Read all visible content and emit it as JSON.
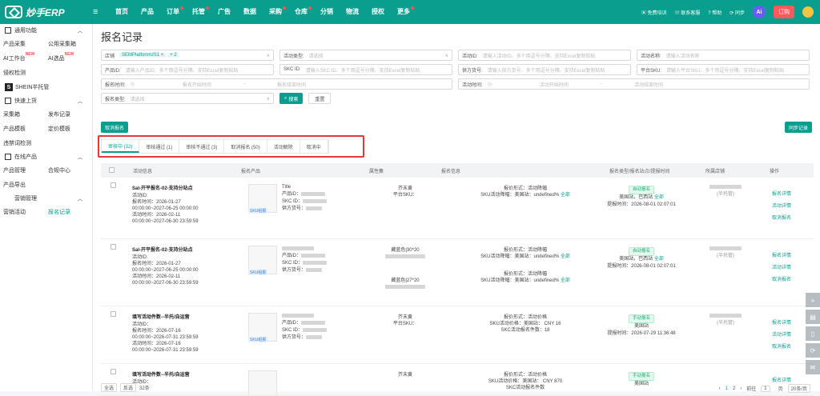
{
  "app": {
    "logo": "妙手ERP",
    "menu_toggle": "≡"
  },
  "nav": [
    {
      "label": "首页",
      "dot": false
    },
    {
      "label": "产品",
      "dot": false
    },
    {
      "label": "订单",
      "dot": true
    },
    {
      "label": "托管",
      "dot": true
    },
    {
      "label": "广告",
      "dot": false
    },
    {
      "label": "数据",
      "dot": false
    },
    {
      "label": "采购",
      "dot": true
    },
    {
      "label": "仓库",
      "dot": true
    },
    {
      "label": "分销",
      "dot": false
    },
    {
      "label": "物流",
      "dot": false
    },
    {
      "label": "授权",
      "dot": false
    },
    {
      "label": "更多",
      "dot": true
    }
  ],
  "topright": {
    "training": "免费培训",
    "service": "联系客服",
    "help": "帮助",
    "sync": "同步",
    "ai": "Ai",
    "order": "订购"
  },
  "sidebar": {
    "g1": "通用功能",
    "r1": [
      "产品采集",
      "公用采集箱"
    ],
    "r2": [
      "AI工作台",
      "AI选品"
    ],
    "hot": "NEW",
    "r3": "侵权检测",
    "shein": "SHEIN半托管",
    "g2": "快速上货",
    "r4": [
      "采集箱",
      "发布记录"
    ],
    "r5": [
      "产品模板",
      "定价模板"
    ],
    "r6": "违禁词检测",
    "g3": "在线产品",
    "r7": [
      "产品管理",
      "合规中心"
    ],
    "r8": "产品导出",
    "g4": "营销管理",
    "r9": [
      "营销活动",
      "报名记录"
    ]
  },
  "page": {
    "title": "报名记录"
  },
  "filters": {
    "shop_label": "店铺",
    "shop_tag": "SEMPlatformUS1",
    "shop_more": "+ 2",
    "act_type_label": "活动类型:",
    "act_type_ph": "请选择",
    "act_id_label": "活动ID:",
    "act_id_ph": "请输入活动ID、多个用逗号分隔、支持Excel复制粘贴",
    "act_name_label": "活动名称:",
    "act_name_ph": "请输入活动名称",
    "prod_id_label": "产品ID:",
    "prod_id_ph": "请输入产品ID、多个用逗号分隔、支持Excel复制粘贴",
    "skc_label": "SKC ID:",
    "skc_ph": "请输入SKC ID、多个用逗号分隔、支持Excel复制粘贴",
    "supplier_label": "供方货号:",
    "supplier_ph": "请输入供方货号、多个用逗号分隔、支持Excel复制粘贴",
    "sku_label": "平台SKU:",
    "sku_ph": "请输入平台SKU、多个用逗号分隔、支持Excel复制粘贴",
    "signup_time": "报名时间:",
    "start": "报名开始时间",
    "end": "报名结束时间",
    "act_time": "活动时间:",
    "act_start": "活动开始时间",
    "act_end": "活动结束时间",
    "sign_type_label": "报名类型:",
    "sign_type_ph": "请选择",
    "search": "搜索",
    "reset": "重置"
  },
  "actions": {
    "cancel": "取消报名",
    "sync": "同步记录"
  },
  "tabs": [
    "审核中 (32)",
    "审核通过 (1)",
    "审核不通过 (3)",
    "取消报名 (50)",
    "活动解除",
    "取消中"
  ],
  "table": {
    "headers": [
      "活动信息",
      "报名产品",
      "属性集",
      "报名信息",
      "报名类型/报名站点/提报时间",
      "所属店铺",
      "操作"
    ],
    "rows": [
      {
        "name": "Sal-开平报名-02-支持分站点",
        "id": "活动ID:",
        "t1": "报名时间：2026-01-27",
        "t2": "00:00:00~2027-06-25 00:00:00",
        "t3": "活动时间：2026-02-11",
        "t4": "00:00:00~2027-06-30 23:59:59",
        "title": "Title",
        "p1": "产品ID：",
        "p2": "SKC ID：",
        "p3": "供方货号：",
        "attr1": "芥末黄",
        "attr2": "平台SKU：",
        "pr1": "报价形式：活动降幅",
        "pr2": "SKU活动降幅：美国站：undefined%",
        "pr2link": "全部",
        "type": "自动报名",
        "site": "美国站，巴西站",
        "sitelink": "全部",
        "time": "提报时间：2026-08-01 02:07:01",
        "shop": "(半托管)",
        "ops": [
          "报名详情",
          "活动详情",
          "取消报名"
        ]
      },
      {
        "name": "Sal-开平报名-02-支持分站点",
        "id": "活动ID:",
        "t1": "报名时间：2026-01-27",
        "t2": "00:00:00~2027-06-25 00:00:00",
        "t3": "活动时间：2026-02-11",
        "t4": "00:00:00~2027-06-30 23:59:59",
        "title": "",
        "p1": "产品ID：",
        "p2": "SKC ID：",
        "p3": "供方货号：",
        "attr1": "藏蓝色|30*20",
        "attr2": "藏蓝色|27*20",
        "pr1": "报价形式：活动降幅",
        "pr2": "SKU活动降幅：美国站：undefined%",
        "pr2link": "全部",
        "type": "自动报名",
        "site": "美国站，巴西站",
        "sitelink": "全部",
        "time": "提报时间：2026-08-01 02:07:01",
        "shop": "(半托管)",
        "ops": [
          "报名详情",
          "活动详情",
          "取消报名"
        ]
      },
      {
        "name": "填写活动件数--半托/自运营",
        "id": "活动ID：",
        "t1": "报名时间：2026-07-16",
        "t2": "00:00:00~2026-07-31 23:59:59",
        "t3": "活动时间：2026-07-16",
        "t4": "00:00:00~2026-07-31 23:59:59",
        "title": "",
        "p1": "产品ID：",
        "p2": "SKC ID：",
        "p3": "供方货号：",
        "attr1": "芥末黄",
        "attr2": "平台SKU：",
        "pr1": "报价形式：活动价格",
        "pr2": "SKU活动价格：美国站： CNY 16",
        "pr3": "SKC活动报名件数：18",
        "type": "手动报名",
        "site": "美国站",
        "time": "提报时间：2026-07-29 11:36:48",
        "shop": "(半托管)",
        "ops": [
          "报名详情",
          "活动详情",
          "取消报名"
        ]
      },
      {
        "name": "填写活动件数--半托/自运营",
        "id": "活动ID：",
        "t1": "",
        "t2": "",
        "t3": "",
        "t4": "",
        "title": "",
        "p1": "",
        "p2": "",
        "p3": "",
        "attr1": "芥末黄",
        "attr2": "",
        "pr1": "报价形式：活动价格",
        "pr2": "SKU活动价格：美国站： CNY 870",
        "pr3": "SKC活动报名件数",
        "type": "手动报名",
        "site": "美国站",
        "time": "",
        "shop": "",
        "ops": [
          "报名详情"
        ]
      }
    ]
  },
  "footer": {
    "all": "全选",
    "invert": "反选",
    "count": "32条",
    "p1": "1",
    "p2": "2",
    "goto": "前往",
    "page": "1",
    "unit": "页",
    "size": "20条/页"
  },
  "skulabel": "SKU组报"
}
